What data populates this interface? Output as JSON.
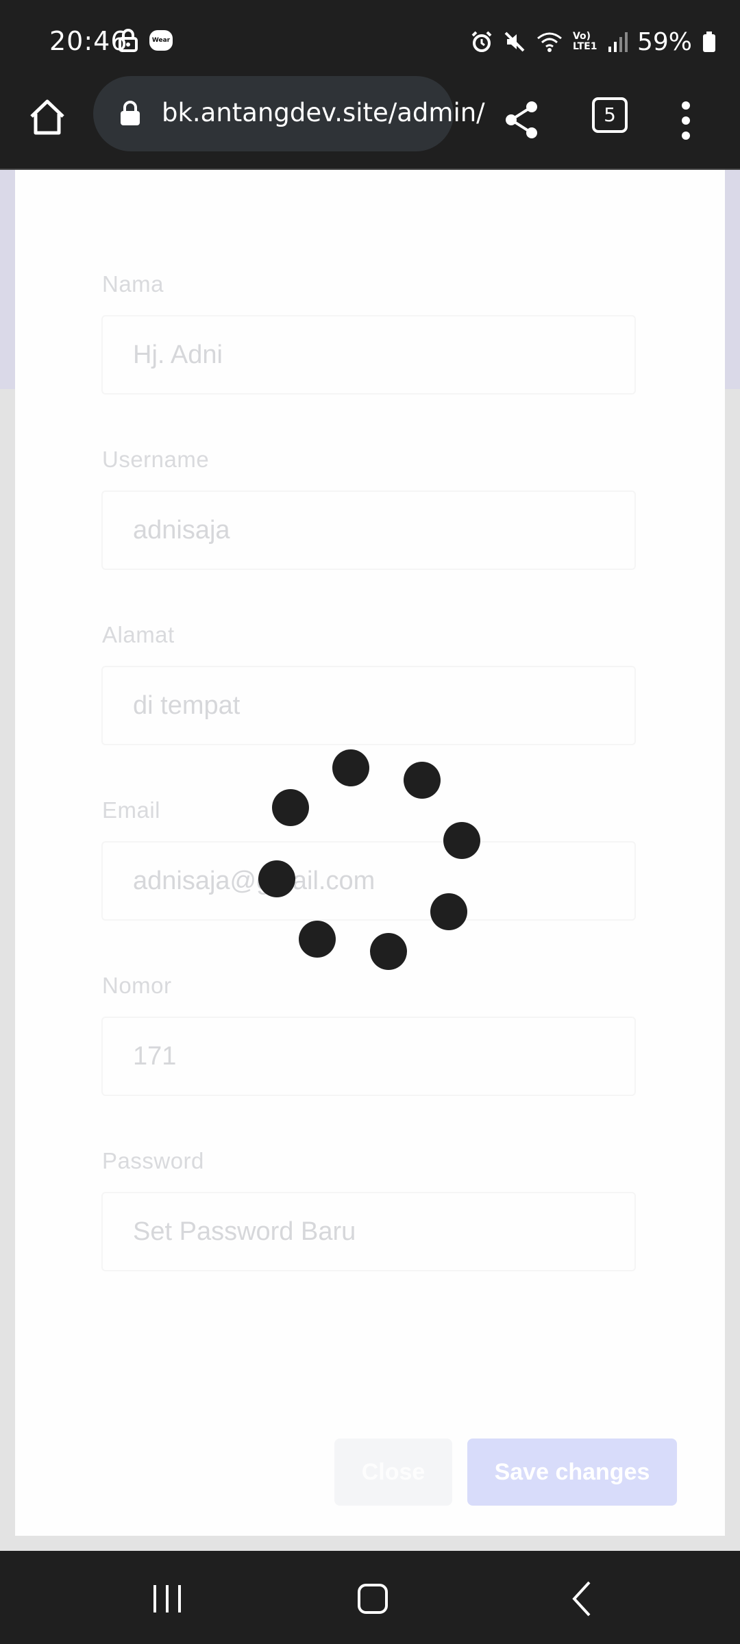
{
  "status_bar": {
    "time": "20:46",
    "wear_badge": "Wear",
    "network_label": "Vo) LTE1",
    "battery": "59%"
  },
  "browser": {
    "url": "bk.antangdev.site/admin/",
    "tab_count": "5"
  },
  "form": {
    "fields": [
      {
        "label": "Nama",
        "value": "Hj. Adni"
      },
      {
        "label": "Username",
        "value": "adnisaja"
      },
      {
        "label": "Alamat",
        "value": "di tempat"
      },
      {
        "label": "Email",
        "value": "adnisaja@gmail.com"
      },
      {
        "label": "Nomor",
        "value": "171"
      },
      {
        "label": "Password",
        "placeholder": "Set Password Baru"
      }
    ],
    "close_label": "Close",
    "save_label": "Save changes"
  },
  "colors": {
    "bar_background": "#1f1f1f",
    "save_button": "#d8dcfa",
    "spinner": "#1f1f1f"
  }
}
